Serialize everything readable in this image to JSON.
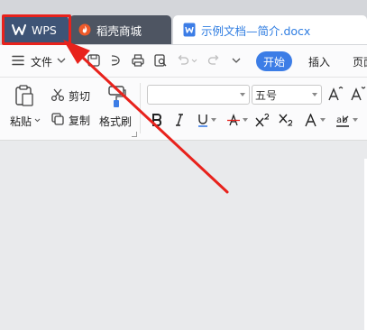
{
  "tabs": [
    {
      "label": "WPS",
      "icon": "wps-logo-icon"
    },
    {
      "label": "稻壳商城",
      "icon": "docer-flame-icon"
    },
    {
      "label": "示例文档—简介.docx",
      "icon": "word-doc-icon"
    }
  ],
  "menu": {
    "file_label": "文件",
    "start_label": "开始",
    "insert_label": "插入",
    "page_label": "页面"
  },
  "ribbon": {
    "paste_label": "粘贴",
    "cut_label": "剪切",
    "copy_label": "复制",
    "format_painter_label": "格式刷",
    "font_name_value": "",
    "font_size_value": "五号"
  },
  "colors": {
    "tab_wps_bg": "#3e5476",
    "tab_shop_bg": "#4e5562",
    "accent": "#3c7de6",
    "annotation_red": "#e8221c"
  }
}
